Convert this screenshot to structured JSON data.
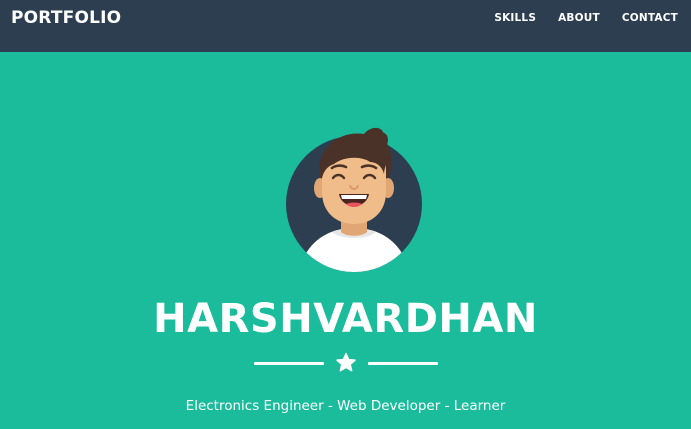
{
  "navbar": {
    "brand": "PORTFOLIO",
    "links": [
      {
        "label": "SKILLS"
      },
      {
        "label": "ABOUT"
      },
      {
        "label": "CONTACT"
      }
    ]
  },
  "hero": {
    "avatar_icon": "avatar-icon",
    "name": "HARSHVARDHAN",
    "divider_icon": "star-icon",
    "tagline": "Electronics Engineer - Web Developer - Learner"
  },
  "colors": {
    "navbar_bg": "#2C3E50",
    "hero_bg": "#1ABC9C",
    "text": "#FFFFFF"
  }
}
